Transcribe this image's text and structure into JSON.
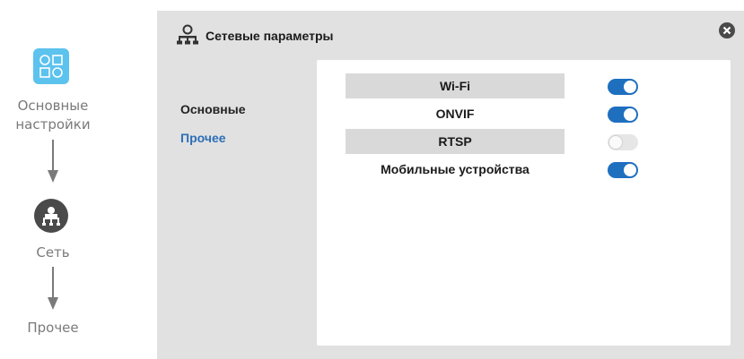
{
  "flow": {
    "step1_line1": "Основные",
    "step1_line2": "настройки",
    "step2": "Сеть",
    "step3": "Прочее"
  },
  "dialog": {
    "title": "Сетевые параметры",
    "menu": [
      "Основные",
      "Прочее"
    ],
    "active_menu": "Прочее",
    "settings": [
      {
        "label": "Wi-Fi",
        "enabled": true
      },
      {
        "label": "ONVIF",
        "enabled": true
      },
      {
        "label": "RTSP",
        "enabled": false
      },
      {
        "label": "Мобильные устройства",
        "enabled": true
      }
    ]
  },
  "icons": {
    "flow_step1": "grid-icon",
    "flow_step2": "network-icon",
    "title": "network-icon",
    "close": "close-icon"
  },
  "colors": {
    "accent": "#1f6fbf",
    "active_menu": "#2e6fb7",
    "app_icon": "#5cc2ee"
  }
}
